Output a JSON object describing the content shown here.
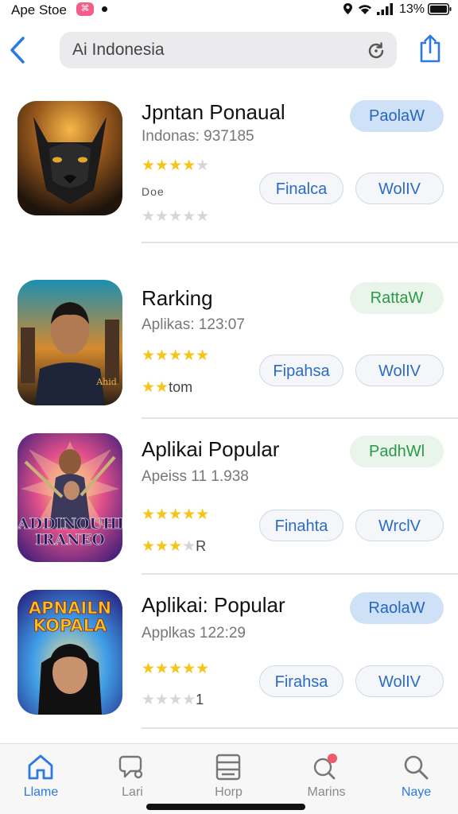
{
  "status_bar": {
    "carrier": "Ape Stoe",
    "badge": "⌘",
    "battery": "13%"
  },
  "nav": {
    "search_text": "Ai Indonesia"
  },
  "apps": [
    {
      "title": "Jpntan Ponaual",
      "subtitle": "Indonas: 937185",
      "rating_stars": 4,
      "secondary_label": "Doe",
      "secondary_stars": 0,
      "secondary_tail": "",
      "primary_button": "PaolaW",
      "primary_style": "blue",
      "button_a": "Finalca",
      "button_b": "WolIV",
      "icon_theme": "panther"
    },
    {
      "title": "Rarking",
      "subtitle": "Aplikas: 123:07",
      "rating_stars": 5,
      "secondary_label": "",
      "secondary_stars": 2,
      "secondary_tail": "tom",
      "primary_button": "RattaW",
      "primary_style": "green",
      "button_a": "Fipahsa",
      "button_b": "WolIV",
      "icon_theme": "hero"
    },
    {
      "title": "Aplikai Popular",
      "subtitle": "Apeiss 11 1.938",
      "rating_stars": 5,
      "secondary_label": "",
      "secondary_stars": 3,
      "secondary_tail": "R",
      "primary_button": "PadhWl",
      "primary_style": "green",
      "button_a": "Finahta",
      "button_b": "WrclV",
      "icon_theme": "warriors",
      "icon_text": "ADDINOUHI IRANEO"
    },
    {
      "title": "Aplikai: Popular",
      "subtitle": "Applkas 122:29",
      "rating_stars": 5,
      "secondary_label": "",
      "secondary_stars": 0,
      "secondary_tail": "1",
      "primary_button": "RaolaW",
      "primary_style": "blue",
      "button_a": "Firahsa",
      "button_b": "WolIV",
      "icon_theme": "woman",
      "icon_text": "APNAILN KOPALA"
    }
  ],
  "tabs": [
    {
      "label": "Llame",
      "icon": "home-icon",
      "active": true
    },
    {
      "label": "Lari",
      "icon": "chat-icon",
      "active": false
    },
    {
      "label": "Horp",
      "icon": "list-icon",
      "active": false
    },
    {
      "label": "Marins",
      "icon": "notification-icon",
      "active": false
    },
    {
      "label": "Naye",
      "icon": "search-icon",
      "active": false
    }
  ],
  "colors": {
    "accent": "#2a7ae2",
    "star": "#f5c518",
    "green": "#2a9a48",
    "notification": "#f05a6b"
  }
}
